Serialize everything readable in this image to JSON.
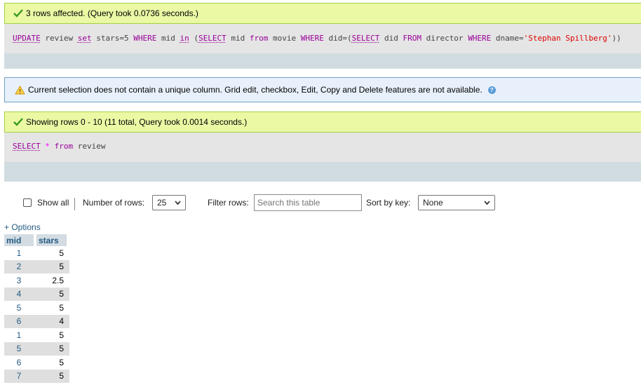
{
  "update_result": {
    "message": "3 rows affected. (Query took 0.0736 seconds.)",
    "sql": {
      "t1": "UPDATE",
      "t2": " review ",
      "t3": "set",
      "t4": " stars=5 ",
      "t5": "WHERE",
      "t6": " mid ",
      "t7": "in",
      "t8": " (",
      "t9": "SELECT",
      "t10": " mid ",
      "t11": "from",
      "t12": " movie ",
      "t13": "WHERE",
      "t14": " did=(",
      "t15": "SELECT",
      "t16": " did ",
      "t17": "FROM",
      "t18": " director ",
      "t19": "WHERE",
      "t20": " dname=",
      "t21": "'Stephan Spillberg'",
      "t22": "))"
    }
  },
  "notice": {
    "message": "Current selection does not contain a unique column. Grid edit, checkbox, Edit, Copy and Delete features are not available."
  },
  "select_result": {
    "message": "Showing rows 0 - 10 (11 total, Query took 0.0014 seconds.)",
    "sql": {
      "kw1": "SELECT",
      "star": "*",
      "kw2": "from",
      "table": "review"
    }
  },
  "controls": {
    "show_all_label": "Show all",
    "num_rows_label": "Number of rows:",
    "num_rows_value": "25",
    "filter_label": "Filter rows:",
    "filter_placeholder": "Search this table",
    "sort_label": "Sort by key:",
    "sort_value": "None"
  },
  "options_label": "+ Options",
  "table": {
    "headers": [
      "mid",
      "stars"
    ],
    "rows": [
      [
        "1",
        "5"
      ],
      [
        "2",
        "5"
      ],
      [
        "3",
        "2.5"
      ],
      [
        "4",
        "5"
      ],
      [
        "5",
        "5"
      ],
      [
        "6",
        "4"
      ],
      [
        "1",
        "5"
      ],
      [
        "5",
        "5"
      ],
      [
        "6",
        "5"
      ],
      [
        "7",
        "5"
      ]
    ]
  },
  "colors": {
    "success_bg": "#ebf8a4",
    "notice_bg": "#e8f1fb",
    "link": "#235a81"
  }
}
